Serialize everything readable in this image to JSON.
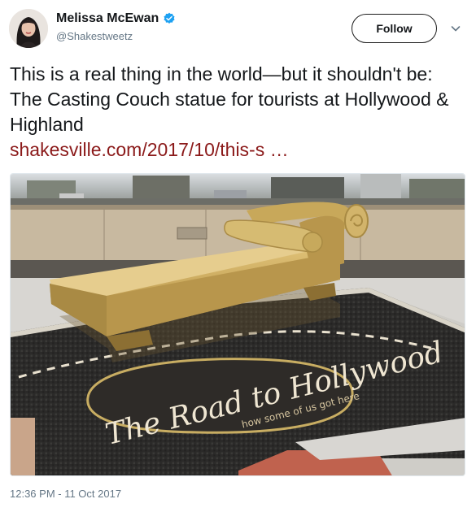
{
  "author": {
    "name": "Melissa McEwan",
    "handle": "@Shakestweetz",
    "verified": true,
    "avatar_icon": "user-avatar"
  },
  "actions": {
    "follow_label": "Follow",
    "more_icon": "chevron-down-icon"
  },
  "tweet": {
    "text": "This is a real thing in the world—but it shouldn't be: The Casting Couch statue for tourists at Hollywood & Highland",
    "link": "shakesville.com/2017/10/this-s …",
    "timestamp": "12:36 PM - 11 Oct 2017"
  },
  "media": {
    "mosaic_title": "The Road to Hollywood",
    "mosaic_subtitle": "how some of us got here"
  },
  "colors": {
    "link": "#8b1a1a",
    "verified": "#1da1f2",
    "muted": "#657786"
  }
}
